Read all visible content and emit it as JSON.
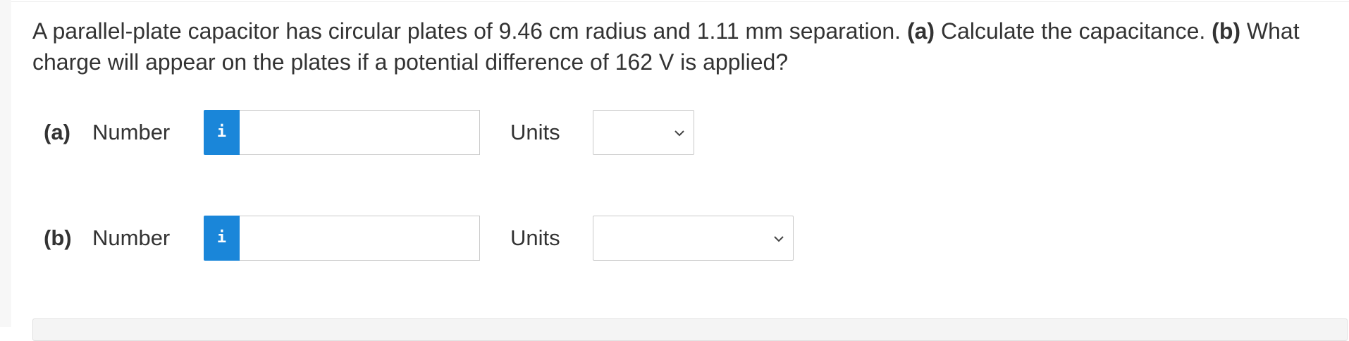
{
  "question": {
    "intro": "A parallel-plate capacitor has circular plates of 9.46 cm radius and 1.11 mm separation. ",
    "part_a_label": "(a)",
    "part_a_text": " Calculate the capacitance. ",
    "part_b_label": "(b)",
    "part_b_text": " What charge will appear on the plates if a potential difference of 162 V is applied?"
  },
  "answers": [
    {
      "part": "(a)",
      "number_label": "Number",
      "info_icon": "i",
      "number_value": "",
      "units_label": "Units",
      "units_selected": ""
    },
    {
      "part": "(b)",
      "number_label": "Number",
      "info_icon": "i",
      "number_value": "",
      "units_label": "Units",
      "units_selected": ""
    }
  ],
  "icons": {
    "info": "info-icon",
    "dropdown": "chevron-down-icon"
  },
  "colors": {
    "info_button": "#1a86d9",
    "text": "#333333",
    "input_border": "#c9c9c9"
  }
}
